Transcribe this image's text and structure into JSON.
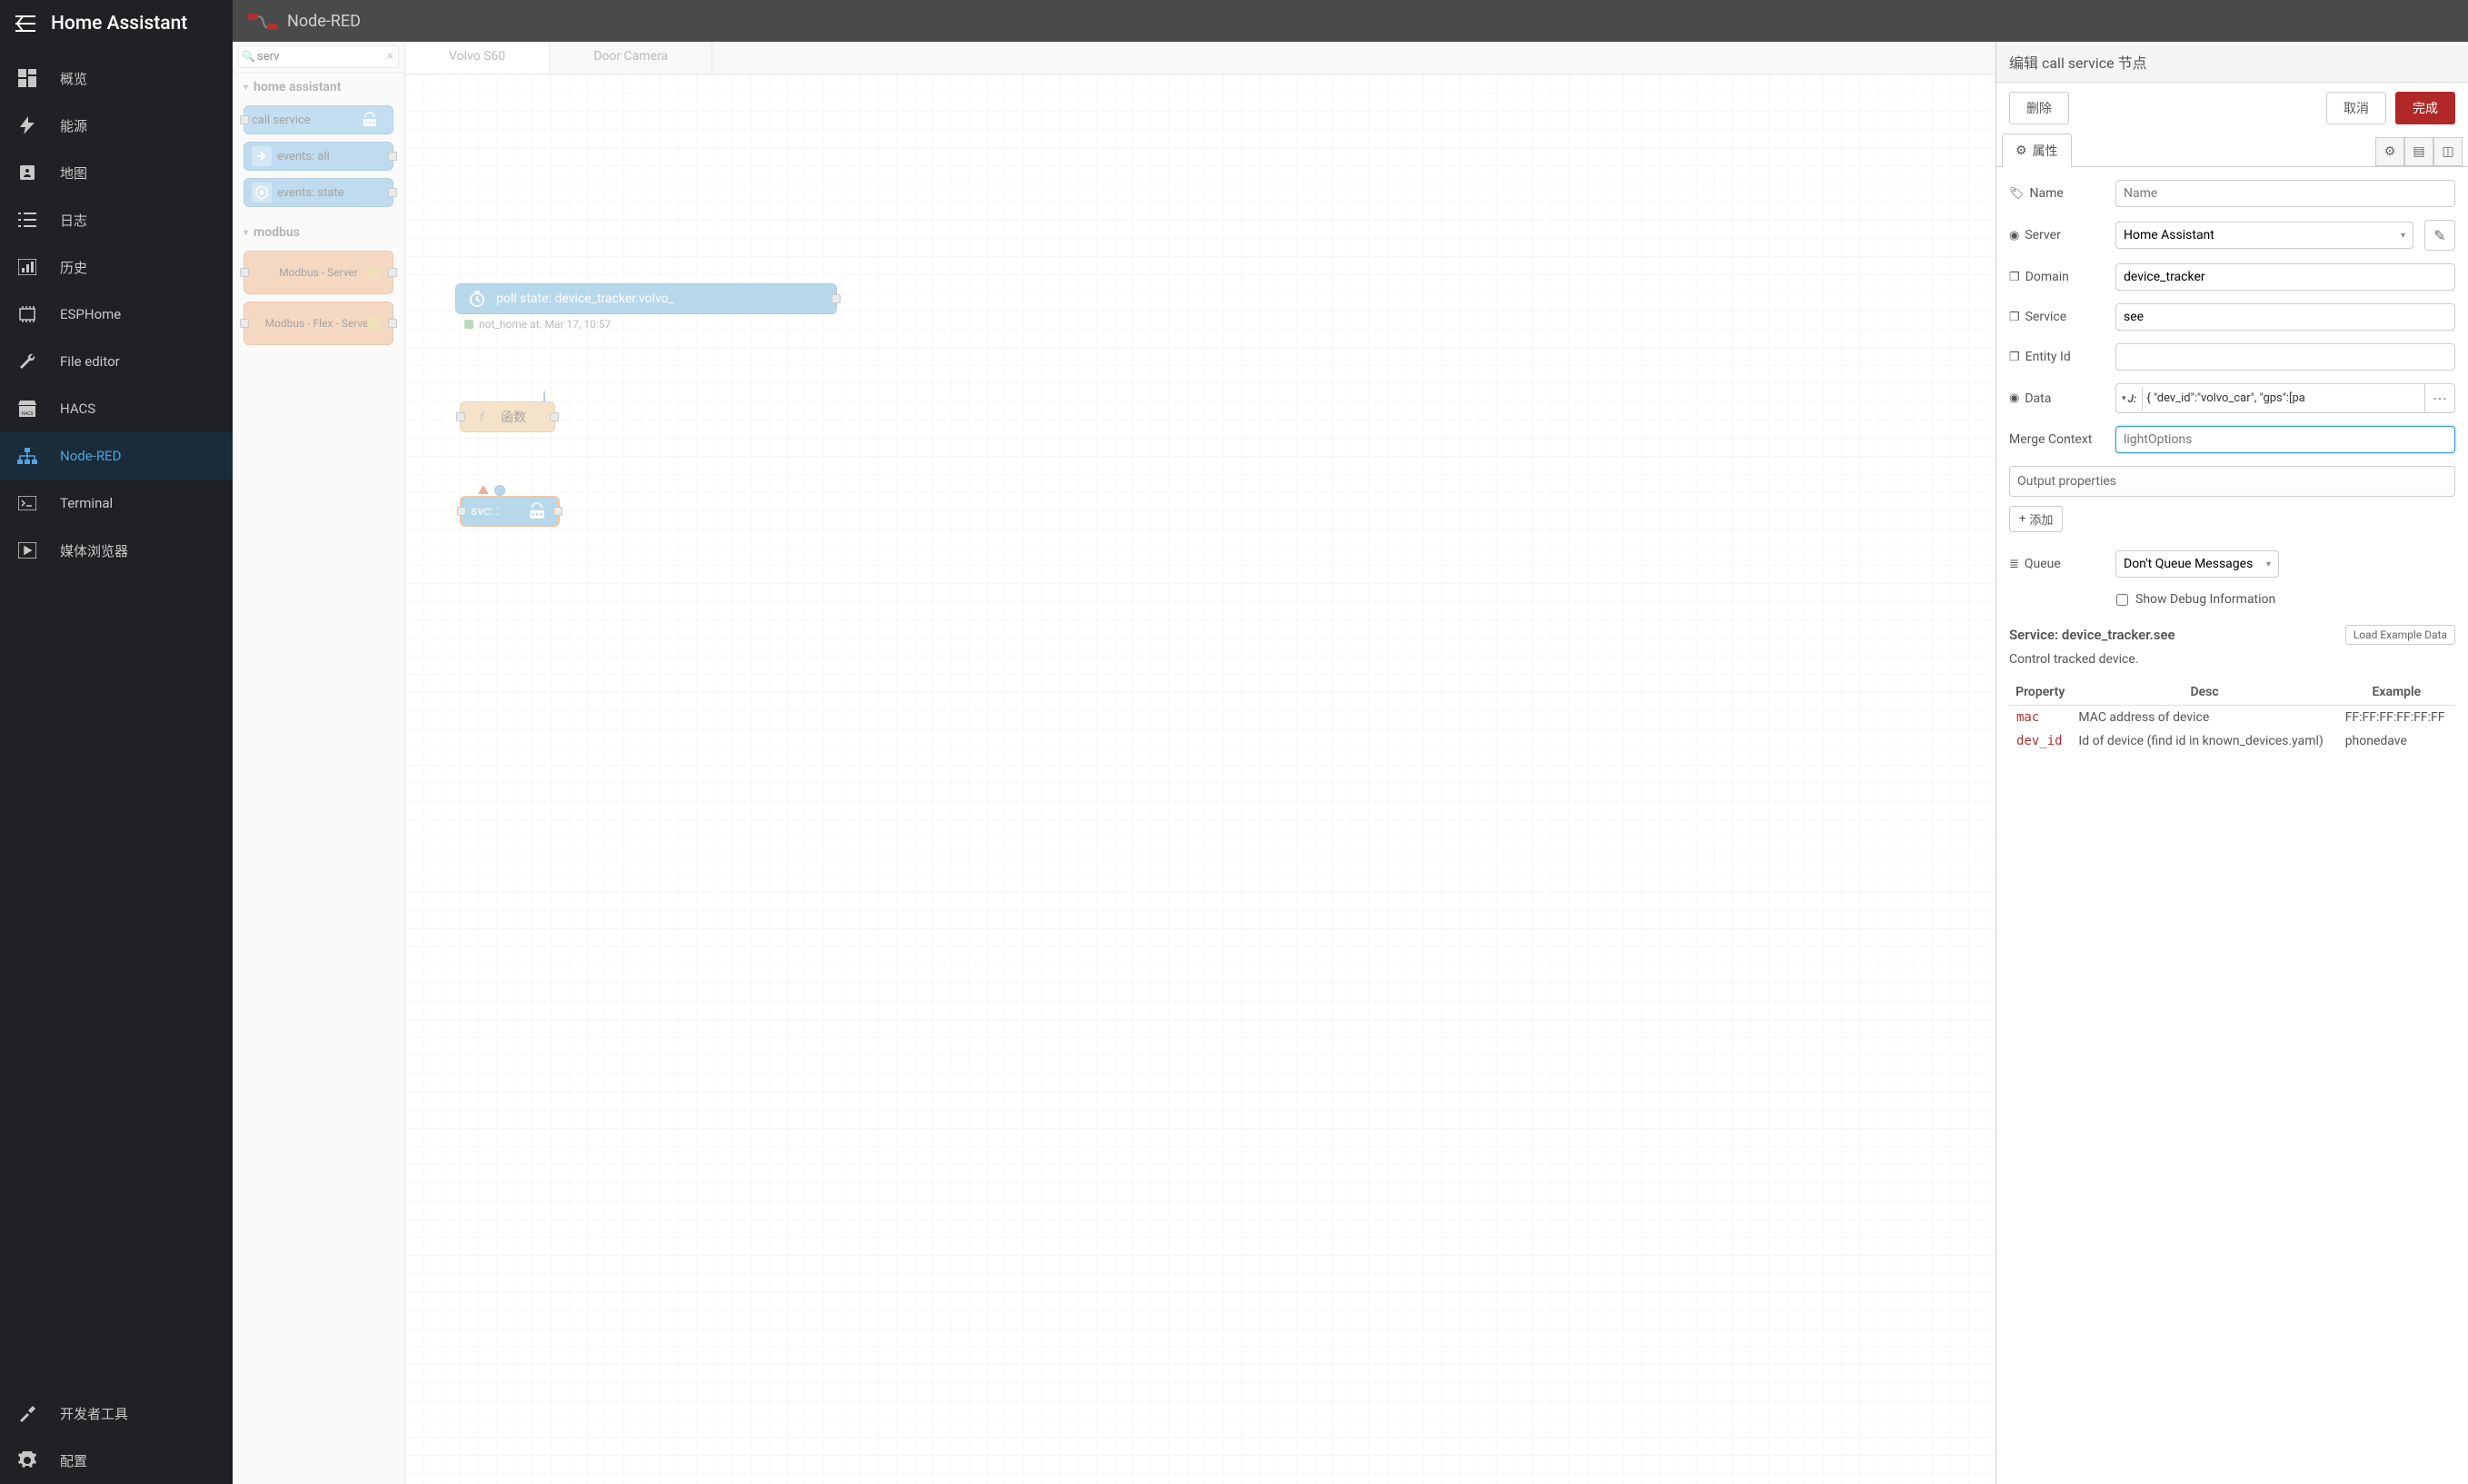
{
  "ha": {
    "title": "Home Assistant",
    "nav": {
      "overview": "概览",
      "energy": "能源",
      "map": "地图",
      "logs": "日志",
      "history": "历史",
      "esphome": "ESPHome",
      "file_editor": "File editor",
      "hacs": "HACS",
      "nodered": "Node-RED",
      "terminal": "Terminal",
      "media": "媒体浏览器",
      "devtools": "开发者工具",
      "settings": "配置"
    }
  },
  "nr": {
    "title": "Node-RED"
  },
  "palette": {
    "search_value": "serv",
    "categories": {
      "ha": "home assistant",
      "modbus": "modbus"
    },
    "nodes": {
      "call_service": "call service",
      "events_all": "events: all",
      "events_state": "events: state",
      "modbus_server": "Modbus - Server",
      "modbus_flex_server": "Modbus - Flex - Server"
    }
  },
  "tabs": {
    "volvo": "Volvo S60",
    "door": "Door Camera"
  },
  "flow": {
    "poll_label": "poll state: device_tracker.volvo_",
    "poll_status": "not_home at: Mar 17, 10:57",
    "func_label": "函数",
    "svc_label": "svc: :"
  },
  "edit": {
    "title": "编辑 call service 节点",
    "delete": "删除",
    "cancel": "取消",
    "done": "完成",
    "tab_props": "属性",
    "labels": {
      "name": "Name",
      "server": "Server",
      "domain": "Domain",
      "service": "Service",
      "entity": "Entity Id",
      "data": "Data",
      "merge": "Merge Context",
      "queue": "Queue"
    },
    "values": {
      "name_placeholder": "Name",
      "server": "Home Assistant",
      "domain": "device_tracker",
      "service": "see",
      "entity": "",
      "data_prefix": "J:",
      "data_content": "{        \"dev_id\":\"volvo_car\",     \"gps\":[pa",
      "merge_placeholder": "lightOptions",
      "queue": "Don't Queue Messages"
    },
    "output_props": "Output properties",
    "add": "添加",
    "show_debug": "Show Debug Information",
    "service_heading": "Service: device_tracker.see",
    "load_example": "Load Example Data",
    "service_desc": "Control tracked device.",
    "table": {
      "h1": "Property",
      "h2": "Desc",
      "h3": "Example",
      "r1": {
        "p": "mac",
        "d": "MAC address of device",
        "e": "FF:FF:FF:FF:FF:FF"
      },
      "r2": {
        "p": "dev_id",
        "d": "Id of device (find id in known_devices.yaml)",
        "e": "phonedave"
      }
    }
  }
}
